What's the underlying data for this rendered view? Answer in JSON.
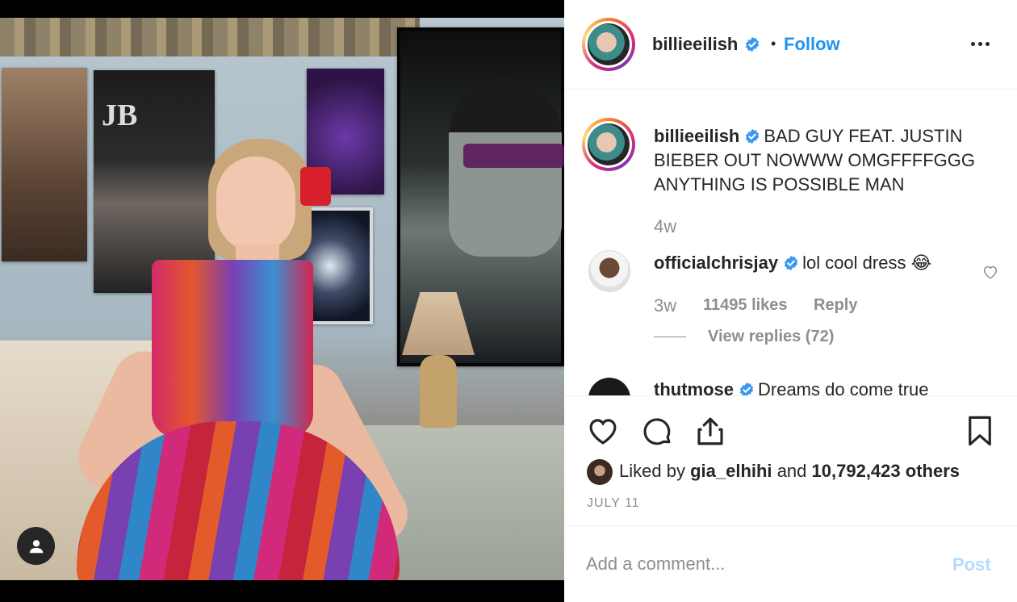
{
  "post": {
    "username": "billieeilish",
    "follow_label": "Follow",
    "separator": "•"
  },
  "caption": {
    "username": "billieeilish",
    "text": "BAD GUY FEAT. JUSTIN BIEBER OUT NOWWW OMGFFFFGGG ANYTHING IS POSSIBLE MAN",
    "time": "4w"
  },
  "comments": [
    {
      "username": "officialchrisjay",
      "text": "lol cool dress 😂",
      "time": "3w",
      "likes": "11495 likes",
      "reply_label": "Reply",
      "view_replies": "View replies (72)"
    },
    {
      "username": "thutmose",
      "text": "Dreams do come true"
    }
  ],
  "photo": {
    "poster_text": "JB"
  },
  "actions": {
    "liked_prefix": "Liked by",
    "liked_user": "gia_elhihi",
    "liked_and": "and",
    "liked_count": "10,792,423 others",
    "date": "JULY 11"
  },
  "composer": {
    "placeholder": "Add a comment...",
    "post_label": "Post"
  },
  "colors": {
    "accent": "#1e93f0",
    "verified": "#3897f0",
    "muted": "#8e8e8e"
  },
  "icons": [
    "user-icon",
    "verified-icon",
    "more-icon",
    "heart-icon",
    "comment-icon",
    "share-icon",
    "bookmark-icon"
  ]
}
